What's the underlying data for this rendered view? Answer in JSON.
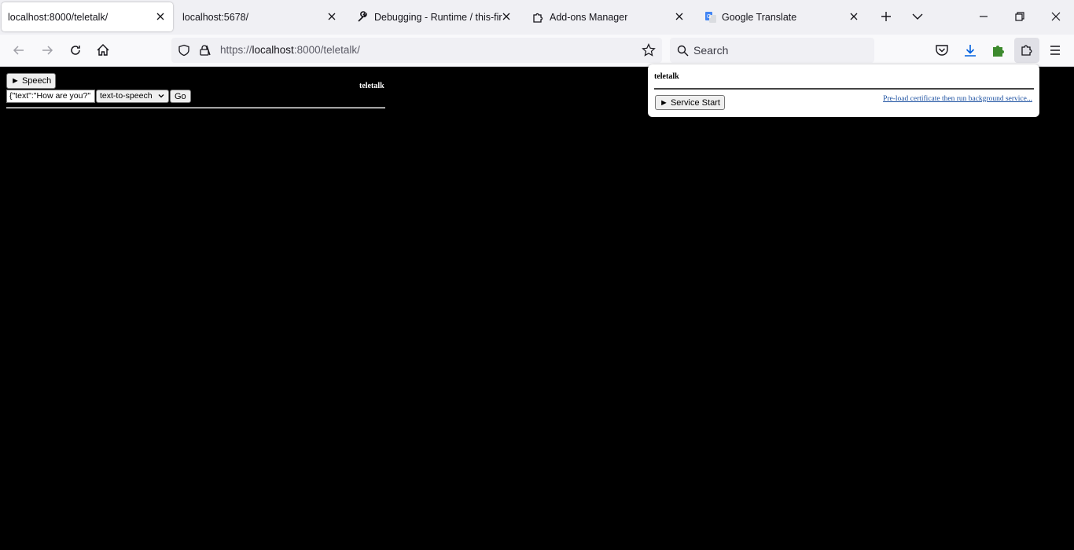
{
  "tabs": [
    {
      "title": "localhost:8000/teletalk/",
      "active": true
    },
    {
      "title": "localhost:5678/",
      "active": false
    },
    {
      "title": "Debugging - Runtime / this-fir",
      "active": false,
      "icon": "wrench-icon"
    },
    {
      "title": "Add-ons Manager",
      "active": false,
      "icon": "puzzle-icon"
    },
    {
      "title": "Google Translate",
      "active": false,
      "icon": "google-translate-icon"
    }
  ],
  "navbar": {
    "url_scheme": "https://",
    "url_host": "localhost",
    "url_rest": ":8000/teletalk/",
    "search_placeholder": "Search"
  },
  "page": {
    "speech_button": "► Speech",
    "request_input_value": "{\"text\":\"How are you?\"",
    "mode_selected": "text-to-speech",
    "go_button": "Go",
    "title": "teletalk"
  },
  "popup": {
    "title": "teletalk",
    "service_start_button": "► Service Start",
    "preload_link": "Pre-load certificate then run background service..."
  },
  "colors": {
    "page_background": "#000000",
    "tabstrip_background": "#f0f0f4",
    "link": "#1a4fa0"
  }
}
